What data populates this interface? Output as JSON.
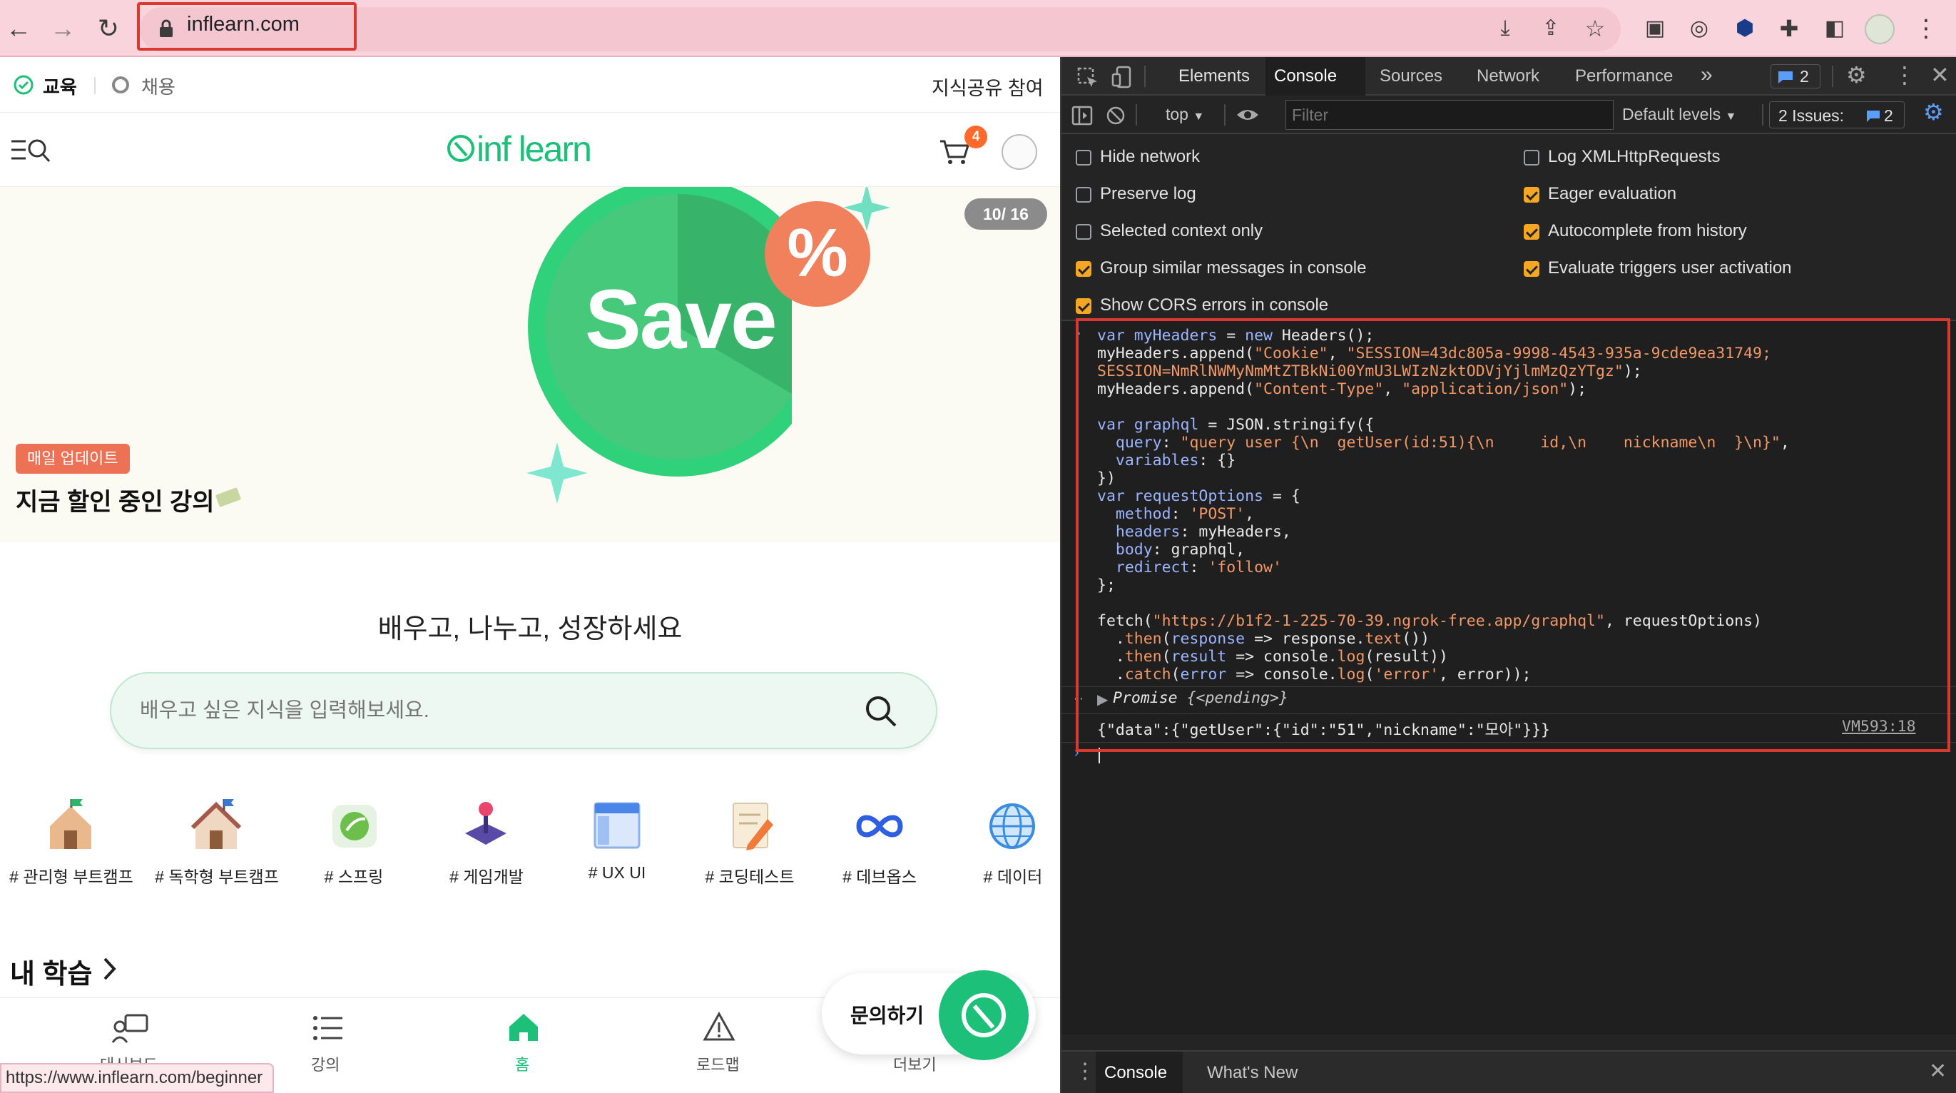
{
  "browser": {
    "url": "inflearn.com",
    "status_url": "https://www.inflearn.com/beginner"
  },
  "site": {
    "top_tabs": {
      "education": "교육",
      "jobs": "채용",
      "share": "지식공유 참여"
    },
    "logo_text": "inf learn",
    "cart_badge": "4",
    "banner": {
      "counter": "10/ 16",
      "save_word": "Save",
      "percent": "%",
      "tag": "매일 업데이트",
      "title": "지금 할인 중인 강의"
    },
    "hero_title": "배우고, 나누고, 성장하세요",
    "search_placeholder": "배우고 싶은 지식을 입력해보세요.",
    "categories": [
      {
        "label": "# 관리형 부트캠프",
        "icon": "house-flag-icon"
      },
      {
        "label": "# 독학형 부트캠프",
        "icon": "house-icon"
      },
      {
        "label": "# 스프링",
        "icon": "spring-leaf-icon"
      },
      {
        "label": "# 게임개발",
        "icon": "joystick-icon"
      },
      {
        "label": "# UX UI",
        "icon": "window-icon"
      },
      {
        "label": "# 코딩테스트",
        "icon": "pencil-note-icon"
      },
      {
        "label": "# 데브옵스",
        "icon": "infinity-icon"
      },
      {
        "label": "# 데이터",
        "icon": "globe-icon"
      }
    ],
    "my_learning": "내 학습",
    "bottom_nav": {
      "dashboard": "대시보드",
      "courses": "강의",
      "home": "홈",
      "roadmap": "로드맵",
      "more": "더보기"
    },
    "inquiry": "문의하기"
  },
  "devtools": {
    "tabs": [
      "Elements",
      "Console",
      "Sources",
      "Network",
      "Performance"
    ],
    "message_badge": "2",
    "context": "top",
    "filter_placeholder": "Filter",
    "levels": "Default levels",
    "issues_label": "2 Issues:",
    "issues_count": "2",
    "settings_left": [
      {
        "label": "Hide network",
        "checked": false
      },
      {
        "label": "Preserve log",
        "checked": false
      },
      {
        "label": "Selected context only",
        "checked": false
      },
      {
        "label": "Group similar messages in console",
        "checked": true
      },
      {
        "label": "Show CORS errors in console",
        "checked": true
      }
    ],
    "settings_right": [
      {
        "label": "Log XMLHttpRequests",
        "checked": false
      },
      {
        "label": "Eager evaluation",
        "checked": true
      },
      {
        "label": "Autocomplete from history",
        "checked": true
      },
      {
        "label": "Evaluate triggers user activation",
        "checked": true
      }
    ],
    "code": {
      "l1a": "var ",
      "l1b": "myHeaders",
      "l1c": " = ",
      "l1d": "new",
      "l1e": " Headers();",
      "l2a": "myHeaders.append(",
      "l2b": "\"Cookie\"",
      "l2c": ", ",
      "l2d": "\"SESSION=43dc805a-9998-4543-935a-9cde9ea31749;",
      "l3a": "SESSION=NmRlNWMyNmMtZTBkNi00YmU3LWIzNzktODVjYjlmMzQzYTgz\"",
      "l3b": ");",
      "l4a": "myHeaders.append(",
      "l4b": "\"Content-Type\"",
      "l4c": ", ",
      "l4d": "\"application/json\"",
      "l4e": ");",
      "l6a": "var ",
      "l6b": "graphql",
      "l6c": " = JSON.stringify({",
      "l7a": "  query",
      "l7b": ": ",
      "l7c": "\"query user {\\n  getUser(id:51){\\n     id,\\n    nickname\\n  }\\n}\"",
      "l7d": ",",
      "l8a": "  variables",
      "l8b": ": {}",
      "l9": "})",
      "l10a": "var ",
      "l10b": "requestOptions",
      "l10c": " = {",
      "l11a": "  method",
      "l11b": ": ",
      "l11c": "'POST'",
      "l11d": ",",
      "l12a": "  headers",
      "l12b": ": myHeaders,",
      "l13a": "  body",
      "l13b": ": graphql,",
      "l14a": "  redirect",
      "l14b": ": ",
      "l14c": "'follow'",
      "l15": "};",
      "l17a": "fetch(",
      "l17b": "\"https://b1f2-1-225-70-39.ngrok-free.app/graphql\"",
      "l17c": ", requestOptions)",
      "l18a": "  .",
      "l18b": "then",
      "l18c": "(",
      "l18d": "response",
      "l18e": " => response.",
      "l18f": "text",
      "l18g": "())",
      "l19a": "  .",
      "l19b": "then",
      "l19c": "(",
      "l19d": "result",
      "l19e": " => console.",
      "l19f": "log",
      "l19g": "(result))",
      "l20a": "  .",
      "l20b": "catch",
      "l20c": "(",
      "l20d": "error",
      "l20e": " => console.",
      "l20f": "log",
      "l20g": "(",
      "l20h": "'error'",
      "l20i": ", error));"
    },
    "promise_label": "Promise",
    "promise_state": "{<pending>}",
    "result": "{\"data\":{\"getUser\":{\"id\":\"51\",\"nickname\":\"모아\"}}}",
    "result_source": "VM593:18",
    "drawer_tabs": [
      "Console",
      "What's New"
    ]
  }
}
